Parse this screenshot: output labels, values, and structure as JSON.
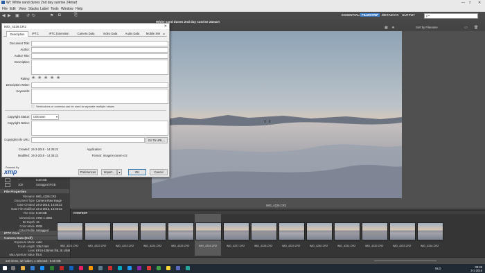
{
  "window": {
    "title": "Wl: White sand dunes 2nd day sunrise 24mart",
    "controls": [
      "—",
      "□",
      "✕"
    ]
  },
  "menu": [
    "File",
    "Edit",
    "View",
    "Stacks",
    "Label",
    "Tools",
    "Window",
    "Help"
  ],
  "workspaces": [
    {
      "label": "ESSENTIALS",
      "active": false
    },
    {
      "label": "FILMSTRIP",
      "active": true
    },
    {
      "label": "METADATA",
      "active": false
    },
    {
      "label": "OUTPUT",
      "active": false
    }
  ],
  "search": {
    "placeholder": "ρ~"
  },
  "pathbar": {
    "crumb": "White sand dunes 2nd day sunrise 24mart"
  },
  "viewbar": {
    "sort_label": "Sort by Filename"
  },
  "dialog": {
    "title": "IMG_4226.CR2",
    "tabs": [
      {
        "label": "Description",
        "selected": true
      },
      {
        "label": "IPTC",
        "selected": false
      },
      {
        "label": "IPTC Extension",
        "selected": false
      },
      {
        "label": "Camera Data",
        "selected": false
      },
      {
        "label": "Video Data",
        "selected": false
      },
      {
        "label": "Audio Data",
        "selected": false
      },
      {
        "label": "Mobile SW",
        "selected": false
      }
    ],
    "fields": {
      "document_title": "Document Title:",
      "author": "Author:",
      "author_title": "Author Title:",
      "description": "Description:",
      "rating": "Rating:",
      "description_writer": "Description Writer:",
      "keywords": "Keywords:",
      "keywords_hint": "Semicolons or commas can be used to separate multiple values",
      "copyright_status": "Copyright Status:",
      "copyright_status_value": "Unknown",
      "copyright_notice": "Copyright Notice:",
      "copyright_info_url": "Copyright Info URL:",
      "goto_url": "Go To URL...",
      "created_label": "Created:",
      "created_value": "24-3-2015 - 14:35:22",
      "modified_label": "Modified:",
      "modified_value": "24-3-2015 - 14:35:22",
      "application_label": "Application:",
      "format_label": "Format:",
      "format_value": "image/x-canon-cr2"
    },
    "rating": 0,
    "brand": {
      "powered_by": "Powered By",
      "logo": "xmp"
    },
    "buttons": {
      "preferences": "Preferences",
      "import": "Import...",
      "ok": "OK",
      "cancel": "Cancel"
    }
  },
  "left_panel": {
    "top_rows": [
      {
        "k": "--",
        "v": "8.50 MB"
      },
      {
        "k": "100",
        "v": "Untagged   RGB"
      }
    ],
    "file_properties": {
      "title": "File Properties",
      "rows": [
        {
          "k": "Filename",
          "v": "IMG_4226.CR2"
        },
        {
          "k": "Document Type",
          "v": "Camera Raw image"
        },
        {
          "k": "Date Created",
          "v": "24-3-2015, 14:35:22"
        },
        {
          "k": "Date File Modified",
          "v": "24-3-2015, 14:35:22"
        },
        {
          "k": "File Size",
          "v": "8.50 MB"
        },
        {
          "k": "Dimensions",
          "v": "2784 x 1856"
        },
        {
          "k": "Bit Depth",
          "v": "16"
        },
        {
          "k": "Color Mode",
          "v": "RGB"
        },
        {
          "k": "Color Profile",
          "v": "Untagged"
        }
      ]
    },
    "iptc_core": {
      "title": "IPTC Core"
    },
    "camera_data": {
      "title": "Camera Data (Exif)",
      "rows": [
        {
          "k": "Exposure Mode",
          "v": "Auto"
        },
        {
          "k": "Focal Length",
          "v": "105.0 mm"
        },
        {
          "k": "Lens",
          "v": "EF24-105mm f/4L IS USM"
        },
        {
          "k": "Max Aperture Value",
          "v": "f/4.0"
        }
      ]
    }
  },
  "preview": {
    "filename": "IMG_4226.CR2"
  },
  "content": {
    "title": "CONTENT",
    "selected_index": 5,
    "thumbs": [
      "IMG_4221.CR2",
      "IMG_4222.CR2",
      "IMG_4223.CR2",
      "IMG_4224.CR2",
      "IMG_4225.CR2",
      "IMG_4226.CR2",
      "IMG_4227.CR2",
      "IMG_4228.CR2",
      "IMG_4229.CR2",
      "IMG_4230.CR2",
      "IMG_4231.CR2",
      "IMG_4232.CR2",
      "IMG_4233.CR2",
      "IMG_4234.CR2"
    ]
  },
  "status": {
    "text": "230 items, 32 hidden, 1 selected - 8.50 MB"
  },
  "clock": {
    "time": "08:49",
    "date": "3-1-2016",
    "lang": "NLD"
  },
  "colors": {
    "accent": "#3b7fd0",
    "panel": "#3c3c3c",
    "dialog": "#f0f0f0"
  }
}
